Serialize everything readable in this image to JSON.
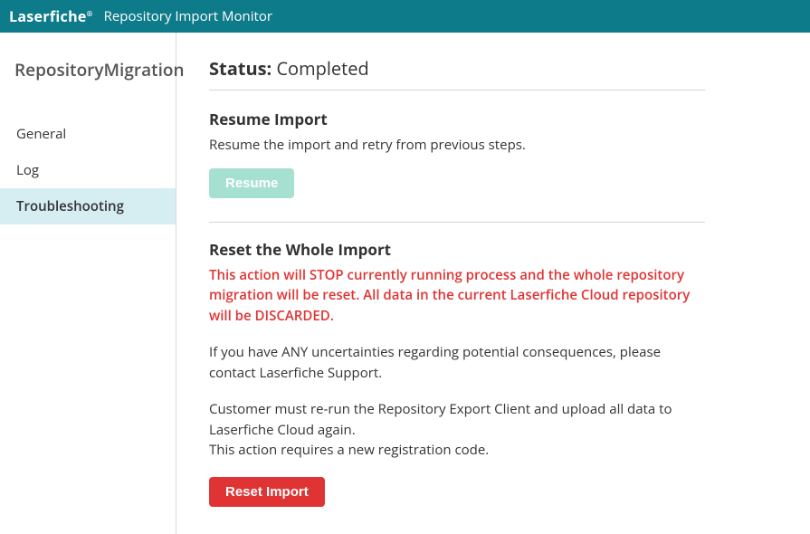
{
  "header": {
    "logo": "Laserfiche",
    "app_title": "Repository Import Monitor"
  },
  "sidebar": {
    "title": "RepositoryMigration",
    "items": [
      {
        "label": "General"
      },
      {
        "label": "Log"
      },
      {
        "label": "Troubleshooting"
      }
    ]
  },
  "status": {
    "label": "Status:",
    "value": "Completed"
  },
  "resume_section": {
    "title": "Resume Import",
    "desc": "Resume the import and retry from previous steps.",
    "button_label": "Resume"
  },
  "reset_section": {
    "title": "Reset the Whole Import",
    "warn_line1": "This action will STOP currently running process and the whole repository migration will be reset.",
    "warn_line2": "All data in the current Laserfiche Cloud repository will be DISCARDED.",
    "para1": "If you have ANY uncertainties regarding potential consequences, please contact Laserfiche Support.",
    "para2_line1": "Customer must re-run the Repository Export Client and upload all data to Laserfiche Cloud again.",
    "para2_line2": "This action requires a new registration code.",
    "button_label": "Reset Import"
  }
}
